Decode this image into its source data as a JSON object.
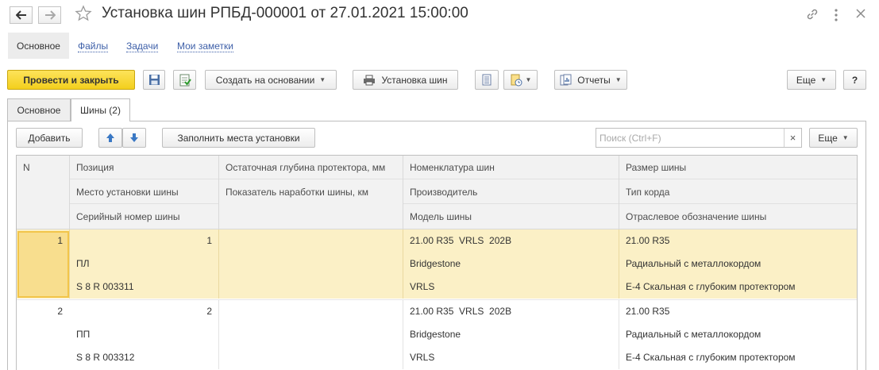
{
  "window": {
    "title": "Установка шин РПБД-000001 от 27.01.2021 15:00:00"
  },
  "nav": {
    "tabs": [
      {
        "label": "Основное"
      },
      {
        "label": "Файлы"
      },
      {
        "label": "Задачи"
      },
      {
        "label": "Мои заметки"
      }
    ]
  },
  "toolbar": {
    "post_close": "Провести и закрыть",
    "create_based": "Создать на основании",
    "tire_install": "Установка шин",
    "reports": "Отчеты",
    "more": "Еще",
    "help": "?"
  },
  "tabs": [
    {
      "label": "Основное"
    },
    {
      "label": "Шины (2)"
    }
  ],
  "table_toolbar": {
    "add": "Добавить",
    "fill_places": "Заполнить места установки",
    "search_placeholder": "Поиск (Ctrl+F)",
    "more": "Еще"
  },
  "table": {
    "headers": {
      "n": "N",
      "col1": [
        "Позиция",
        "Место установки шины",
        "Серийный номер шины"
      ],
      "col2": [
        "Остаточная глубина протектора, мм",
        "Показатель наработки шины, км"
      ],
      "col3": [
        "Номенклатура шин",
        "Производитель",
        "Модель шины"
      ],
      "col4": [
        "Размер шины",
        "Тип корда",
        "Отраслевое обозначение шины"
      ]
    },
    "rows": [
      {
        "n": "1",
        "position": "1",
        "place": "ПЛ",
        "serial": "S 8 R 003311",
        "nomenclature": "21.00 R35  VRLS  202B",
        "manufacturer": "Bridgestone",
        "model": "VRLS",
        "size": "21.00 R35",
        "cord": "Радиальный с металлокордом",
        "industry": "E-4 Скальная с глубоким протектором"
      },
      {
        "n": "2",
        "position": "2",
        "place": "ПП",
        "serial": "S 8 R 003312",
        "nomenclature": "21.00 R35  VRLS  202B",
        "manufacturer": "Bridgestone",
        "model": "VRLS",
        "size": "21.00 R35",
        "cord": "Радиальный с металлокордом",
        "industry": "E-4 Скальная с глубоким протектором"
      }
    ]
  },
  "colors": {
    "primary_button": "#f7d82c",
    "selected_row": "#fbf0c6",
    "link": "#3d5fa8"
  }
}
